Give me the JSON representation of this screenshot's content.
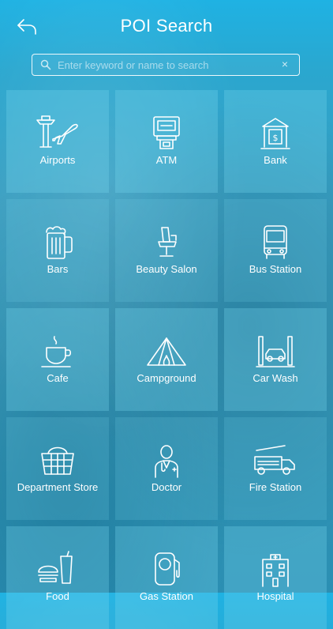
{
  "header": {
    "title": "POI Search",
    "back_icon": "back-arrow-icon"
  },
  "search": {
    "placeholder": "Enter keyword or name to search",
    "value": "",
    "clear_label": "×"
  },
  "categories": [
    {
      "label": "Airports",
      "icon": "airport-icon"
    },
    {
      "label": "ATM",
      "icon": "atm-icon"
    },
    {
      "label": "Bank",
      "icon": "bank-icon"
    },
    {
      "label": "Bars",
      "icon": "beer-mug-icon"
    },
    {
      "label": "Beauty Salon",
      "icon": "salon-chair-icon"
    },
    {
      "label": "Bus Station",
      "icon": "bus-icon"
    },
    {
      "label": "Cafe",
      "icon": "coffee-cup-icon"
    },
    {
      "label": "Campground",
      "icon": "tent-icon"
    },
    {
      "label": "Car Wash",
      "icon": "car-wash-icon"
    },
    {
      "label": "Department Store",
      "icon": "basket-icon"
    },
    {
      "label": "Doctor",
      "icon": "doctor-icon"
    },
    {
      "label": "Fire Station",
      "icon": "fire-truck-icon"
    },
    {
      "label": "Food",
      "icon": "food-icon"
    },
    {
      "label": "Gas Station",
      "icon": "gas-pump-icon"
    },
    {
      "label": "Hospital",
      "icon": "hospital-icon"
    }
  ]
}
